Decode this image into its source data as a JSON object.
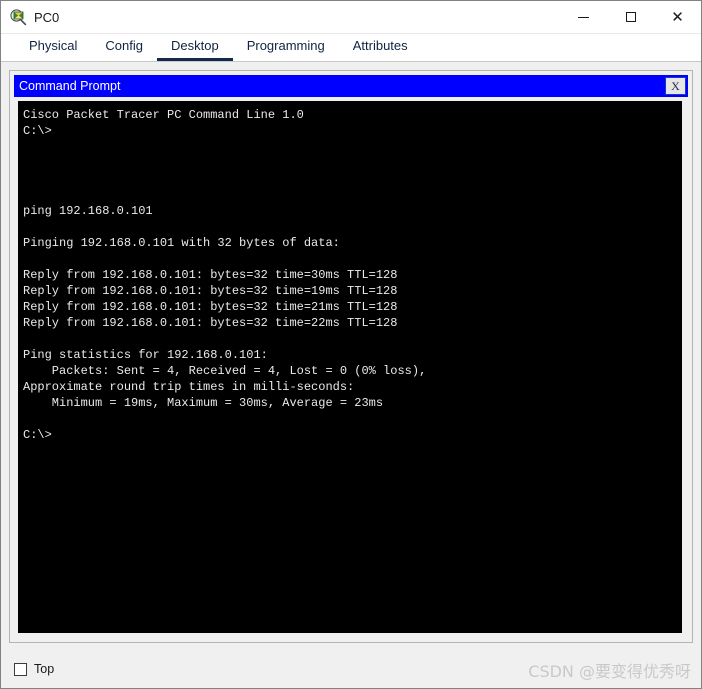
{
  "window": {
    "title": "PC0",
    "icon": "packet-tracer-pc-icon",
    "controls": {
      "minimize": "minimize-icon",
      "maximize": "maximize-icon",
      "close": "close-icon"
    }
  },
  "tabs": [
    {
      "label": "Physical",
      "active": false
    },
    {
      "label": "Config",
      "active": false
    },
    {
      "label": "Desktop",
      "active": true
    },
    {
      "label": "Programming",
      "active": false
    },
    {
      "label": "Attributes",
      "active": false
    }
  ],
  "cmd": {
    "title": "Command Prompt",
    "close_label": "X",
    "terminal_text": "Cisco Packet Tracer PC Command Line 1.0\nC:\\>\n\n\n\n\nping 192.168.0.101\n\nPinging 192.168.0.101 with 32 bytes of data:\n\nReply from 192.168.0.101: bytes=32 time=30ms TTL=128\nReply from 192.168.0.101: bytes=32 time=19ms TTL=128\nReply from 192.168.0.101: bytes=32 time=21ms TTL=128\nReply from 192.168.0.101: bytes=32 time=22ms TTL=128\n\nPing statistics for 192.168.0.101:\n    Packets: Sent = 4, Received = 4, Lost = 0 (0% loss),\nApproximate round trip times in milli-seconds:\n    Minimum = 19ms, Maximum = 30ms, Average = 23ms\n\nC:\\>",
    "lines": [
      "Cisco Packet Tracer PC Command Line 1.0",
      "C:\\>",
      "",
      "",
      "",
      "",
      "ping 192.168.0.101",
      "",
      "Pinging 192.168.0.101 with 32 bytes of data:",
      "",
      "Reply from 192.168.0.101: bytes=32 time=30ms TTL=128",
      "Reply from 192.168.0.101: bytes=32 time=19ms TTL=128",
      "Reply from 192.168.0.101: bytes=32 time=21ms TTL=128",
      "Reply from 192.168.0.101: bytes=32 time=22ms TTL=128",
      "",
      "Ping statistics for 192.168.0.101:",
      "    Packets: Sent = 4, Received = 4, Lost = 0 (0% loss),",
      "Approximate round trip times in milli-seconds:",
      "    Minimum = 19ms, Maximum = 30ms, Average = 23ms",
      "",
      "C:\\>"
    ],
    "ping_target": "192.168.0.101",
    "packet_size_bytes": "32",
    "reply_times_ms": [
      "30",
      "19",
      "21",
      "22"
    ],
    "ttl": "128",
    "packets_sent": "4",
    "packets_received": "4",
    "packets_lost": "0",
    "loss_percent": "0%",
    "rtt_min_ms": "19ms",
    "rtt_max_ms": "30ms",
    "rtt_avg_ms": "23ms"
  },
  "footer": {
    "top_checkbox_label": "Top",
    "top_checked": false,
    "watermark": "CSDN @要变得优秀呀"
  },
  "colors": {
    "cmd_titlebar": "#0000ff",
    "terminal_bg": "#000000",
    "terminal_fg": "#eaeaea",
    "active_tab_underline": "#12294d",
    "window_bg": "#f0f0f0"
  }
}
